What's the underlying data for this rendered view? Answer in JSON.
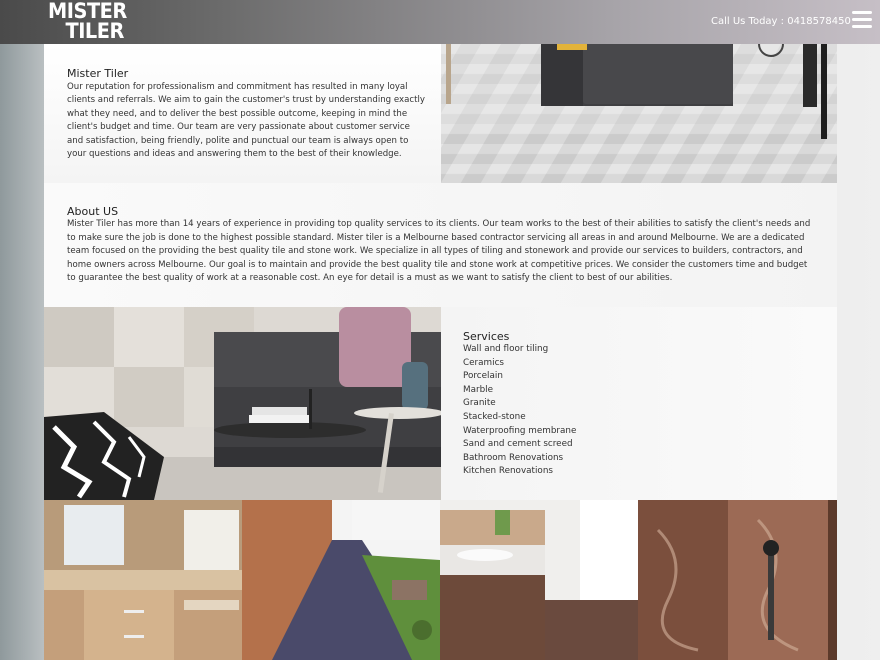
{
  "header": {
    "logo_line1": "MISTER",
    "logo_line2": "TILER",
    "call_text": "Call Us Today : 0418578450",
    "menu_icon": "hamburger-menu-icon"
  },
  "intro": {
    "title": "Mister Tiler",
    "text": "Our reputation for professionalism and commitment has resulted in many loyal clients and referrals. We aim to gain the customer's trust by understanding exactly what they need, and to deliver the best possible outcome, keeping in mind the client's budget and time. Our team are very passionate about customer service and satisfaction, being friendly, polite and punctual our team is always open to your questions and ideas and answering them to the best of their knowledge."
  },
  "about": {
    "title": "About US",
    "text": "Mister Tiler has more than 14 years of experience in providing top quality services to its clients. Our team works to the best of their abilities to satisfy the client's needs and to make sure the job is done to the highest possible standard. Mister tiler is a Melbourne based contractor servicing all areas in and around Melbourne. We are a dedicated team focused on the providing the best quality tile and stone work. We specialize in all types of tiling and stonework and provide our services to builders, contractors, and home owners across Melbourne. Our goal is to maintain and provide the best quality tile and stone work at competitive prices. We consider the customers time and budget to guarantee the best quality of work at a reasonable cost. An eye for detail is a must as we want to satisfy the client to best of our abilities."
  },
  "services": {
    "title": "Services",
    "items": [
      "Wall and floor tiling",
      "Ceramics",
      "Porcelain",
      "Marble",
      "Granite",
      "Stacked-stone",
      "Waterproofing membrane",
      "Sand and cement screed",
      "Bathroom Renovations",
      "Kitchen Renovations"
    ]
  },
  "colors": {
    "header_start": "#4a4a4a",
    "header_end": "#c6bfc6",
    "sofa": "#3f3f42",
    "cushion": "#b98ea0"
  }
}
